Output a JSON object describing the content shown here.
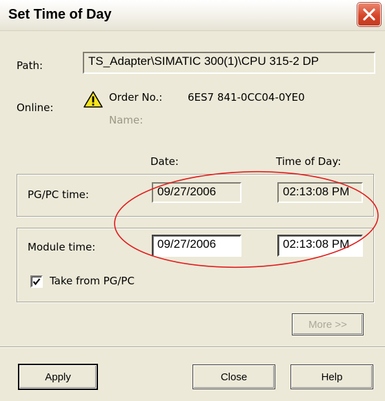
{
  "window": {
    "title": "Set Time of Day",
    "close_icon": "close-icon"
  },
  "path": {
    "label": "Path:",
    "value": "TS_Adapter\\SIMATIC 300(1)\\CPU 315-2 DP"
  },
  "online": {
    "label": "Online:",
    "warning_icon": "warning-icon",
    "order_label": "Order No.:",
    "order_value": "6ES7 841-0CC04-0YE0",
    "name_label": "Name:"
  },
  "columns": {
    "date": "Date:",
    "time": "Time of Day:"
  },
  "pgpc": {
    "label": "PG/PC time:",
    "date": "09/27/2006",
    "time": "02:13:08 PM"
  },
  "module": {
    "label": "Module time:",
    "date": "09/27/2006",
    "time": "02:13:08 PM",
    "take_from_label": "Take from PG/PC",
    "take_from_checked": true
  },
  "buttons": {
    "more": "More >>",
    "apply": "Apply",
    "close": "Close",
    "help": "Help"
  },
  "annotation": {
    "ellipse_color": "#e31b1b"
  }
}
